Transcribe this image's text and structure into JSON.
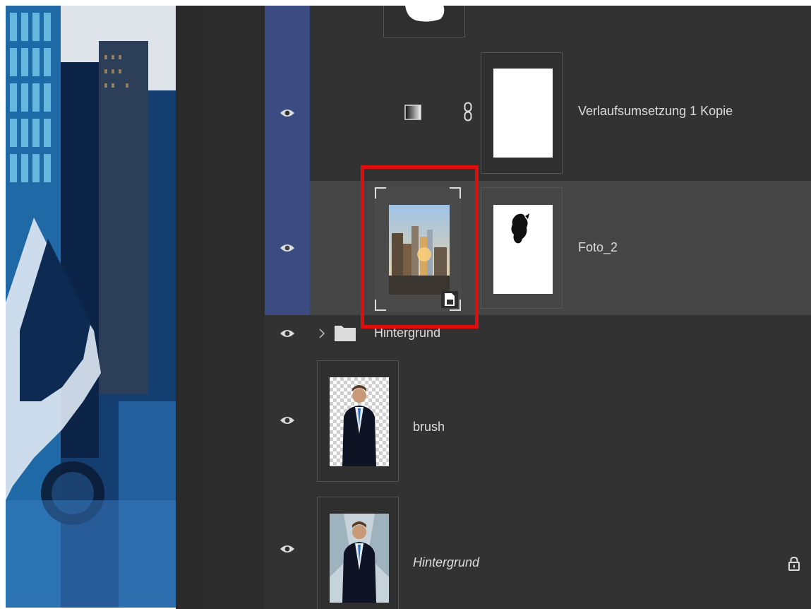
{
  "layers_panel": {
    "layers": [
      {
        "name": "",
        "type": "mask-stub"
      },
      {
        "name": "Verlaufsumsetzung 1 Kopie",
        "type": "adjustment",
        "visible": true,
        "linked": true
      },
      {
        "name": "Foto_2",
        "type": "smart-object",
        "visible": true,
        "selected": true
      },
      {
        "name": "Hintergrund",
        "type": "group",
        "visible": true,
        "collapsed": true
      },
      {
        "name": "brush",
        "type": "pixel",
        "visible": true
      },
      {
        "name": "Hintergrund",
        "type": "background",
        "visible": true,
        "locked": true
      }
    ]
  },
  "colors": {
    "panel_bg": "#313131",
    "selected_row": "#454545",
    "linked_stripe": "#3c4b82",
    "highlight": "#e00d0d"
  },
  "icons": {
    "eye": "eye-icon",
    "gradient": "gradient-map-icon",
    "chain": "chain-link-icon",
    "folder": "folder-icon",
    "chevron": "chevron-right-icon",
    "lock": "lock-icon",
    "smart_object": "smart-object-badge-icon"
  }
}
